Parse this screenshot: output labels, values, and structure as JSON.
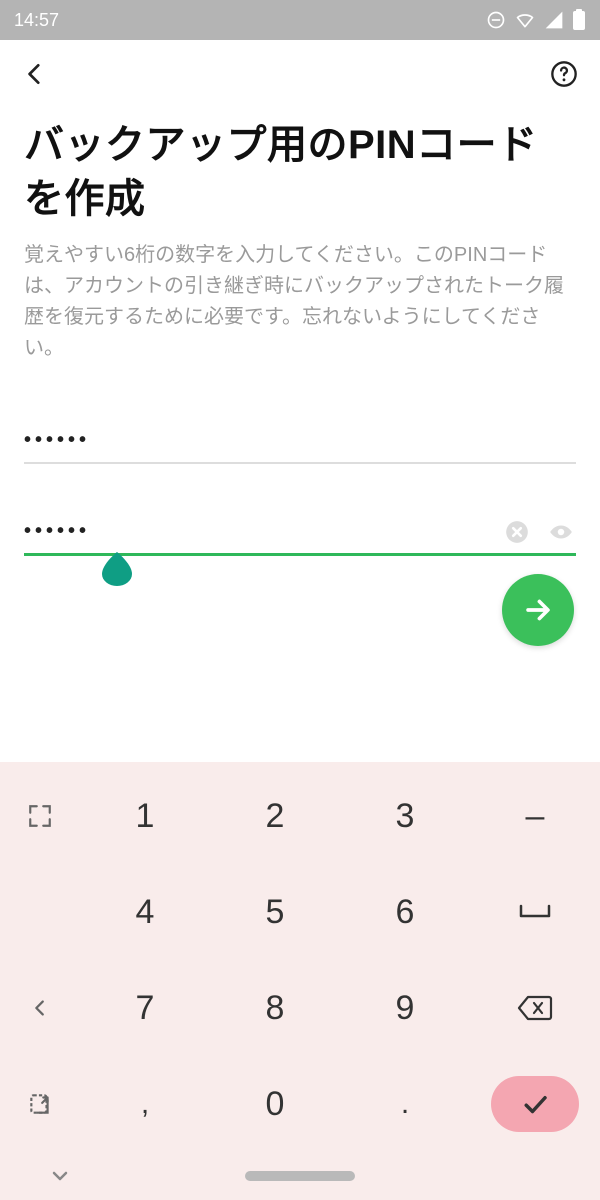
{
  "statusbar": {
    "time": "14:57"
  },
  "page": {
    "title": "バックアップ用のPINコードを作成",
    "description": "覚えやすい6桁の数字を入力してください。このPINコードは、アカウントの引き継ぎ時にバックアップされたトーク履歴を復元するために必要です。忘れないようにしてください。"
  },
  "pin": {
    "first_masked": "••••••",
    "confirm_masked": "••••••"
  },
  "keypad": {
    "k1": "1",
    "k2": "2",
    "k3": "3",
    "k4": "4",
    "k5": "5",
    "k6": "6",
    "k7": "7",
    "k8": "8",
    "k9": "9",
    "k0": "0",
    "dash": "–",
    "underscore": "⎵",
    "comma": ",",
    "period": "."
  },
  "colors": {
    "accent": "#2fb85a",
    "fab": "#3bc05b",
    "kbd_bg": "#f9eceb",
    "enter": "#f4a6b1"
  }
}
